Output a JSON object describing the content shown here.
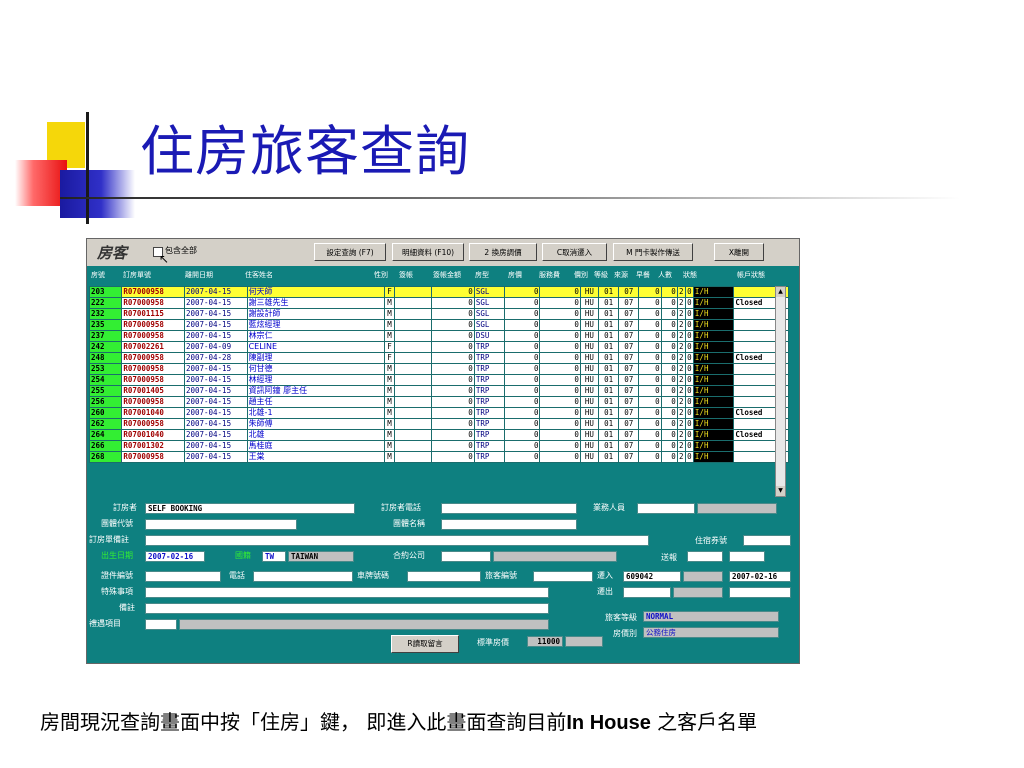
{
  "slide": {
    "title": "住房旅客查詢",
    "caption_pre": "房間現況查詢畫面中按「住房」鍵， 即進入此畫面查詢目前",
    "caption_bold": "In House",
    "caption_post": " 之客戶名單"
  },
  "app": {
    "title": "房客",
    "checkbox_label": "包含全部",
    "buttons": {
      "query_settings": "設定查詢 (F7)",
      "details": "明細資料 (F10)",
      "change_room": "2 換房調價",
      "cancel_checkin": "C取消遷入",
      "door_card": "M 門卡製作傳送",
      "exit": "X離開"
    },
    "columns": {
      "room": "房號",
      "order_no": "訂房單號",
      "checkout": "離開日期",
      "guest": "住客姓名",
      "gender": "性別",
      "discount": "簽帳",
      "discount_amt": "簽帳金額",
      "room_type": "房型",
      "rate": "房價",
      "service": "服務費",
      "price_class": "價別",
      "grade": "等級",
      "source": "來源",
      "breakfast": "早餐",
      "pax": "人數",
      "status": "狀態",
      "account_status": "帳戶狀態"
    },
    "rows": [
      {
        "room": "203",
        "order": "R07000958",
        "date": "2007-04-15",
        "name": "何天師",
        "sex": "F",
        "type": "SGL",
        "rate": "0",
        "svc": "0",
        "cls": "HU",
        "lv": "01",
        "src": "07",
        "bf": "0",
        "pax": "0",
        "n": "2",
        "st": "0",
        "flag": "I/H",
        "acct": "",
        "sel": true
      },
      {
        "room": "222",
        "order": "R07000958",
        "date": "2007-04-15",
        "name": "謝三雄先生",
        "sex": "M",
        "type": "SGL",
        "rate": "0",
        "svc": "0",
        "cls": "HU",
        "lv": "01",
        "src": "07",
        "bf": "0",
        "pax": "0",
        "n": "2",
        "st": "0",
        "flag": "I/H",
        "acct": "Closed"
      },
      {
        "room": "232",
        "order": "R07001115",
        "date": "2007-04-15",
        "name": "謝設計師",
        "sex": "M",
        "type": "SGL",
        "rate": "0",
        "svc": "0",
        "cls": "HU",
        "lv": "01",
        "src": "07",
        "bf": "0",
        "pax": "0",
        "n": "2",
        "st": "0",
        "flag": "I/H",
        "acct": ""
      },
      {
        "room": "235",
        "order": "R07000958",
        "date": "2007-04-15",
        "name": "藍炫經理",
        "sex": "M",
        "type": "SGL",
        "rate": "0",
        "svc": "0",
        "cls": "HU",
        "lv": "01",
        "src": "07",
        "bf": "0",
        "pax": "0",
        "n": "2",
        "st": "0",
        "flag": "I/H",
        "acct": ""
      },
      {
        "room": "237",
        "order": "R07000958",
        "date": "2007-04-15",
        "name": "林宗仁",
        "sex": "M",
        "type": "DSU",
        "rate": "0",
        "svc": "0",
        "cls": "HU",
        "lv": "01",
        "src": "07",
        "bf": "0",
        "pax": "0",
        "n": "2",
        "st": "0",
        "flag": "I/H",
        "acct": ""
      },
      {
        "room": "242",
        "order": "R07002261",
        "date": "2007-04-09",
        "name": "CELINE",
        "sex": "F",
        "type": "TRP",
        "rate": "0",
        "svc": "0",
        "cls": "HU",
        "lv": "01",
        "src": "07",
        "bf": "0",
        "pax": "0",
        "n": "2",
        "st": "0",
        "flag": "I/H",
        "acct": ""
      },
      {
        "room": "248",
        "order": "R07000958",
        "date": "2007-04-28",
        "name": "陳副理",
        "sex": "F",
        "type": "TRP",
        "rate": "0",
        "svc": "0",
        "cls": "HU",
        "lv": "01",
        "src": "07",
        "bf": "0",
        "pax": "0",
        "n": "2",
        "st": "0",
        "flag": "I/H",
        "acct": "Closed"
      },
      {
        "room": "253",
        "order": "R07000958",
        "date": "2007-04-15",
        "name": "何甘德",
        "sex": "M",
        "type": "TRP",
        "rate": "0",
        "svc": "0",
        "cls": "HU",
        "lv": "01",
        "src": "07",
        "bf": "0",
        "pax": "0",
        "n": "2",
        "st": "0",
        "flag": "I/H",
        "acct": ""
      },
      {
        "room": "254",
        "order": "R07000958",
        "date": "2007-04-15",
        "name": "林經理",
        "sex": "M",
        "type": "TRP",
        "rate": "0",
        "svc": "0",
        "cls": "HU",
        "lv": "01",
        "src": "07",
        "bf": "0",
        "pax": "0",
        "n": "2",
        "st": "0",
        "flag": "I/H",
        "acct": ""
      },
      {
        "room": "255",
        "order": "R07001405",
        "date": "2007-04-15",
        "name": "資訊阿鐘 廖主任",
        "sex": "M",
        "type": "TRP",
        "rate": "0",
        "svc": "0",
        "cls": "HU",
        "lv": "01",
        "src": "07",
        "bf": "0",
        "pax": "0",
        "n": "2",
        "st": "0",
        "flag": "I/H",
        "acct": ""
      },
      {
        "room": "256",
        "order": "R07000958",
        "date": "2007-04-15",
        "name": "趙主任",
        "sex": "M",
        "type": "TRP",
        "rate": "0",
        "svc": "0",
        "cls": "HU",
        "lv": "01",
        "src": "07",
        "bf": "0",
        "pax": "0",
        "n": "2",
        "st": "0",
        "flag": "I/H",
        "acct": ""
      },
      {
        "room": "260",
        "order": "R07001040",
        "date": "2007-04-15",
        "name": "北雄-1",
        "sex": "M",
        "type": "TRP",
        "rate": "0",
        "svc": "0",
        "cls": "HU",
        "lv": "01",
        "src": "07",
        "bf": "0",
        "pax": "0",
        "n": "2",
        "st": "0",
        "flag": "I/H",
        "acct": "Closed"
      },
      {
        "room": "262",
        "order": "R07000958",
        "date": "2007-04-15",
        "name": "朱師傅",
        "sex": "M",
        "type": "TRP",
        "rate": "0",
        "svc": "0",
        "cls": "HU",
        "lv": "01",
        "src": "07",
        "bf": "0",
        "pax": "0",
        "n": "2",
        "st": "0",
        "flag": "I/H",
        "acct": ""
      },
      {
        "room": "264",
        "order": "R07001040",
        "date": "2007-04-15",
        "name": "北雄",
        "sex": "M",
        "type": "TRP",
        "rate": "0",
        "svc": "0",
        "cls": "HU",
        "lv": "01",
        "src": "07",
        "bf": "0",
        "pax": "0",
        "n": "2",
        "st": "0",
        "flag": "I/H",
        "acct": "Closed"
      },
      {
        "room": "266",
        "order": "R07001302",
        "date": "2007-04-15",
        "name": "馬桂庭",
        "sex": "M",
        "type": "TRP",
        "rate": "0",
        "svc": "0",
        "cls": "HU",
        "lv": "01",
        "src": "07",
        "bf": "0",
        "pax": "0",
        "n": "2",
        "st": "0",
        "flag": "I/H",
        "acct": ""
      },
      {
        "room": "268",
        "order": "R07000958",
        "date": "2007-04-15",
        "name": "王棠",
        "sex": "M",
        "type": "TRP",
        "rate": "0",
        "svc": "0",
        "cls": "HU",
        "lv": "01",
        "src": "07",
        "bf": "0",
        "pax": "0",
        "n": "2",
        "st": "0",
        "flag": "I/H",
        "acct": ""
      }
    ],
    "form": {
      "booker_label": "訂房者",
      "booker_value": "SELF BOOKING",
      "booker_phone_label": "訂房者電話",
      "sales_label": "業務人員",
      "group_code_label": "團體代號",
      "group_name_label": "團體名稱",
      "order_note_label": "訂房單備註",
      "residence_label": "住宿券號",
      "birthday_label": "出生日期",
      "birthday_value": "2007-02-16",
      "nationality_label": "國籍",
      "nationality_code": "TW",
      "nationality_name": "TAIWAN",
      "contract_label": "合約公司",
      "sender_label": "送報",
      "id_label": "證件編號",
      "phone_label": "電話",
      "plate_label": "車牌號碼",
      "guest_no_label": "旅客編號",
      "checkin_label": "遷入",
      "checkin_no": "609042",
      "checkin_date": "2007-02-16",
      "special_label": "特殊事項",
      "checkout_label": "遷出",
      "remark_label": "備註",
      "guest_grade_label": "旅客等級",
      "guest_grade_value": "NORMAL",
      "service_label": "禮遇項目",
      "price_class_label": "房價別",
      "price_class_value": "公務住房",
      "message_button": "R讀取留言",
      "std_rate_label": "標準房價",
      "std_rate_value": "11000"
    }
  }
}
